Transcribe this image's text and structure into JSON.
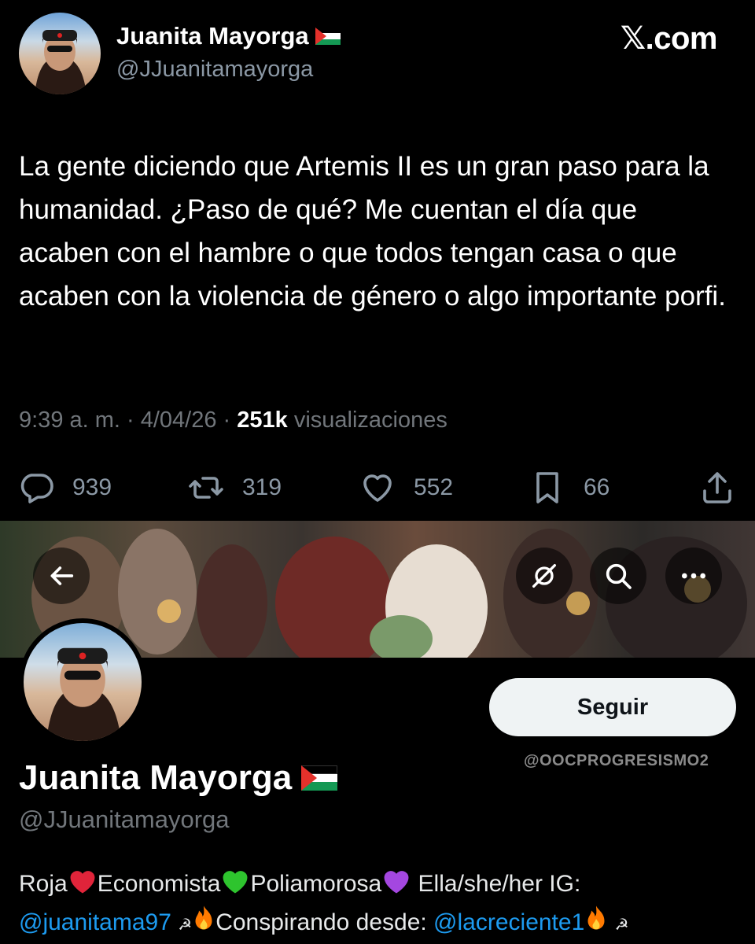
{
  "tweet": {
    "author_name": "Juanita Mayorga",
    "author_handle": "@JJuanitamayorga",
    "brand": "𝕏.com",
    "text": "La gente diciendo que Artemis II es un gran paso para la humanidad. ¿Paso de qué? Me cuentan el día que acaben con el hambre o que todos tengan casa o que acaben con la violencia de género o algo importante porfi.",
    "time": "9:39 a. m. · 4/04/26 · ",
    "views_count": "251k",
    "views_label": " visualizaciones",
    "replies": "939",
    "reposts": "319",
    "likes": "552",
    "bookmarks": "66",
    "icons": [
      "reply-icon",
      "repost-icon",
      "like-icon",
      "bookmark-icon",
      "share-icon"
    ]
  },
  "profile": {
    "follow_label": "Seguir",
    "name": "Juanita Mayorga",
    "handle": "@JJuanitamayorga",
    "watermark": "@OOCPROGRESISMO2",
    "bio": {
      "roja": "Roja",
      "economista": "Economista",
      "poliamorosa": "Poliamorosa",
      "pronouns": " Ella/she/her IG:",
      "ig_link": "@juanitama97",
      "hammer_sickle": "☭",
      "conspirando": "Conspirando desde: ",
      "creciente_link": "@lacreciente1",
      "hammer_sickle_end": "☭"
    },
    "banner_icons": [
      "back-arrow-icon",
      "hide-icon",
      "search-icon",
      "more-icon"
    ]
  },
  "colors": {
    "background": "#000000",
    "text": "#e7e9ea",
    "muted": "#71767b",
    "link": "#1d9bf0",
    "follow_bg": "#eff3f4"
  }
}
